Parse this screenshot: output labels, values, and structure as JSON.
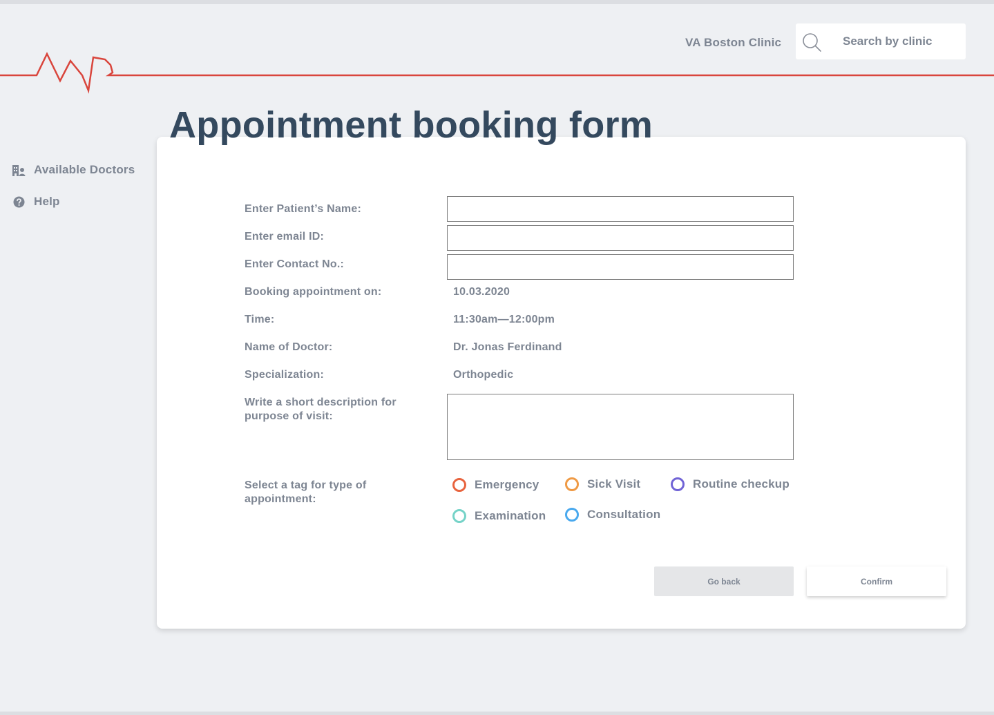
{
  "header": {
    "clinic_name": "VA Boston Clinic",
    "search_placeholder": "Search by clinic",
    "pulse_color": "#d9453c"
  },
  "sidebar": {
    "items": [
      {
        "label": "Available Doctors",
        "icon": "doctors-icon"
      },
      {
        "label": "Help",
        "icon": "help-icon"
      }
    ]
  },
  "form": {
    "title": "Appointment booking form",
    "patient_name_label": "Enter Patient’s Name:",
    "patient_name_value": "",
    "email_label": "Enter email ID:",
    "email_value": "",
    "contact_label": "Enter Contact No.:",
    "contact_value": "",
    "date_label": "Booking appointment on:",
    "date_value": "10.03.2020",
    "time_label": "Time:",
    "time_value": "11:30am—12:00pm",
    "doctor_label": "Name of Doctor:",
    "doctor_value": "Dr. Jonas Ferdinand",
    "specialization_label": "Specialization:",
    "specialization_value": "Orthopedic",
    "description_label": "Write a short description for purpose of visit:",
    "description_value": "",
    "tag_label": "Select a tag for type of appointment:",
    "tags": [
      {
        "label": "Emergency",
        "color": "#e8643f"
      },
      {
        "label": "Sick Visit",
        "color": "#ef9a45"
      },
      {
        "label": "Routine checkup",
        "color": "#7164d6"
      },
      {
        "label": "Examination",
        "color": "#76d3c8"
      },
      {
        "label": "Consultation",
        "color": "#4aa9ee"
      }
    ],
    "go_back_label": "Go back",
    "confirm_label": "Confirm"
  }
}
